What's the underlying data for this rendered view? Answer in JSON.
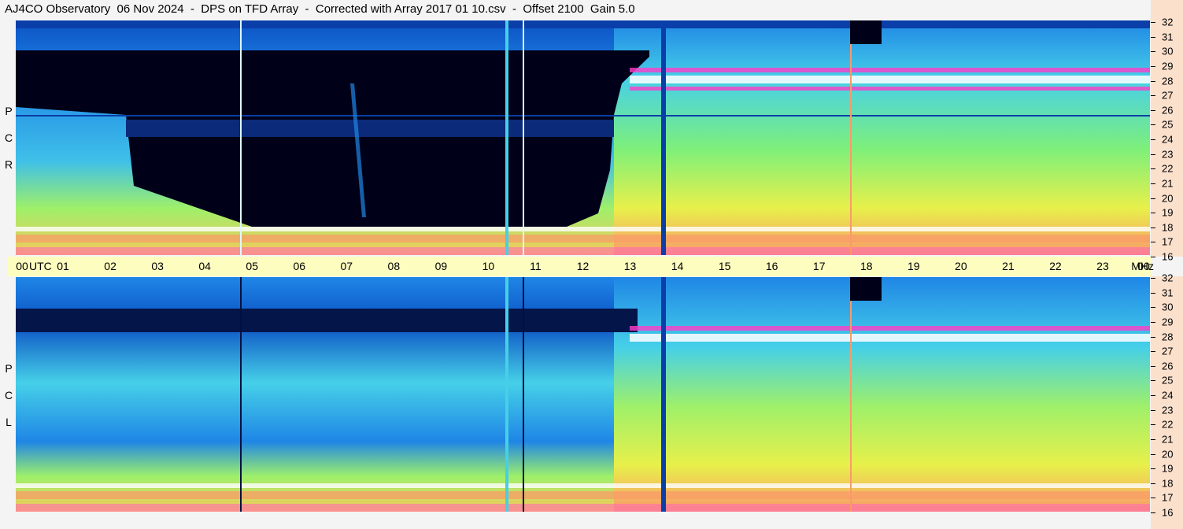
{
  "title": "AJ4CO Observatory  06 Nov 2024  -  DPS on TFD Array  -  Corrected with Array 2017 01 10.csv  -  Offset 2100  Gain 5.0",
  "top_panel_letters": [
    "P",
    "C",
    "R"
  ],
  "bottom_panel_letters": [
    "P",
    "C",
    "L"
  ],
  "time_axis": {
    "unit_left": "UTC",
    "unit_right": "MHz",
    "ticks": [
      "00",
      "01",
      "02",
      "03",
      "04",
      "05",
      "06",
      "07",
      "08",
      "09",
      "10",
      "11",
      "12",
      "13",
      "14",
      "15",
      "16",
      "17",
      "18",
      "19",
      "20",
      "21",
      "22",
      "23",
      "00"
    ]
  },
  "freq_ticks": [
    "32",
    "31",
    "30",
    "29",
    "28",
    "27",
    "26",
    "25",
    "24",
    "23",
    "22",
    "21",
    "20",
    "19",
    "18",
    "17",
    "16"
  ],
  "chart_data": [
    {
      "type": "heatmap",
      "panel": "RCP",
      "xlabel": "UTC",
      "ylabel": "MHz",
      "xlim": [
        0,
        24
      ],
      "ylim": [
        16,
        32
      ],
      "colors": [
        "#000020",
        "#0a3ea8",
        "#1f86e6",
        "#46d0e8",
        "#7ef07a",
        "#f5f043",
        "#f99a6a",
        "#ff3cc8",
        "#ffffff"
      ]
    },
    {
      "type": "heatmap",
      "panel": "LCP",
      "xlabel": "UTC",
      "ylabel": "MHz",
      "xlim": [
        0,
        24
      ],
      "ylim": [
        16,
        32
      ],
      "colors": [
        "#000020",
        "#0a3ea8",
        "#1f86e6",
        "#46d0e8",
        "#7ef07a",
        "#f5f043",
        "#f99a6a",
        "#ff3cc8",
        "#ffffff"
      ]
    }
  ]
}
